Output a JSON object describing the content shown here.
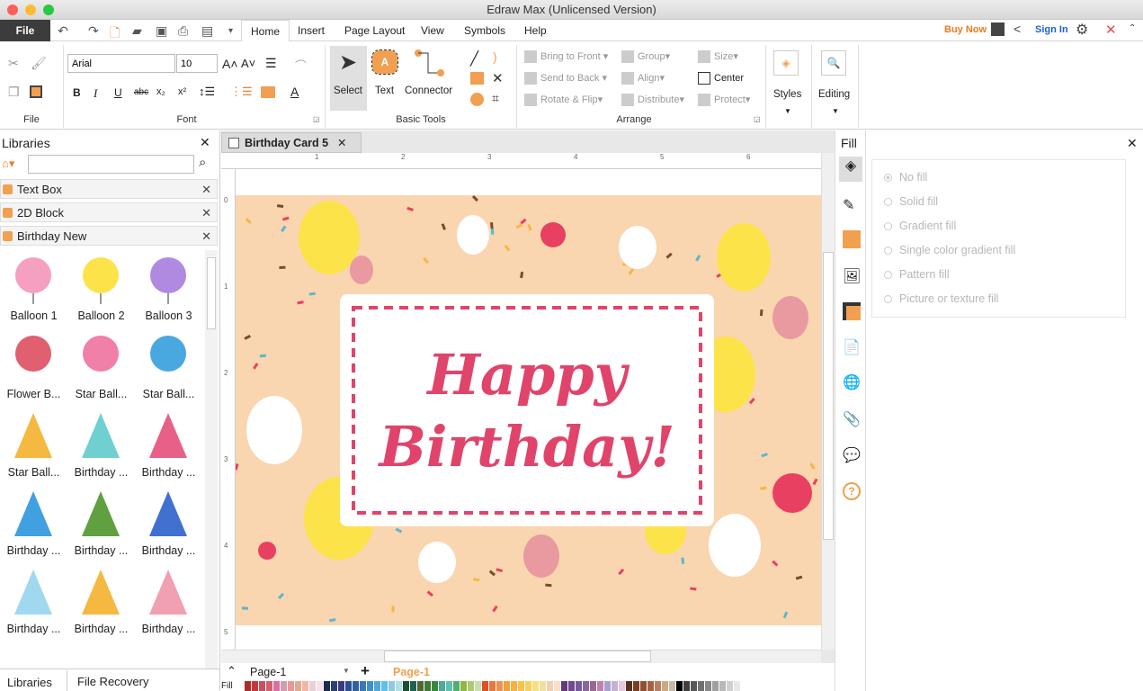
{
  "window": {
    "title": "Edraw Max (Unlicensed Version)"
  },
  "menu": {
    "file": "File",
    "tabs": [
      "Home",
      "Insert",
      "Page Layout",
      "View",
      "Symbols",
      "Help"
    ],
    "active": "Home",
    "buy_now": "Buy Now",
    "sign_in": "Sign In"
  },
  "ribbon": {
    "font": {
      "name": "Arial",
      "size": "10"
    },
    "groups": {
      "file": "File",
      "font": "Font",
      "basic_tools": "Basic Tools",
      "arrange": "Arrange"
    },
    "basic_tools": {
      "select": "Select",
      "text": "Text",
      "connector": "Connector"
    },
    "arrange": {
      "bring_to_front": "Bring to Front",
      "send_to_back": "Send to Back",
      "rotate_flip": "Rotate & Flip",
      "group": "Group",
      "align": "Align",
      "distribute": "Distribute",
      "size": "Size",
      "center": "Center",
      "protect": "Protect"
    },
    "styles": "Styles",
    "editing": "Editing"
  },
  "libraries": {
    "title": "Libraries",
    "search_value": "",
    "categories": [
      "Text Box",
      "2D Block",
      "Birthday New"
    ],
    "shapes": [
      "Balloon 1",
      "Balloon 2",
      "Balloon 3",
      "Flower B...",
      "Star Ball...",
      "Star Ball...",
      "Star Ball...",
      "Birthday ...",
      "Birthday ...",
      "Birthday ...",
      "Birthday ...",
      "Birthday ...",
      "Birthday ...",
      "Birthday ...",
      "Birthday ..."
    ],
    "bottom_tabs": [
      "Libraries",
      "File Recovery"
    ]
  },
  "document": {
    "tab": "Birthday Card 5",
    "card_line1": "Happy",
    "card_line2": "Birthday!",
    "ruler_top": [
      "1",
      "2",
      "3",
      "4",
      "5",
      "6"
    ],
    "ruler_left": [
      "0",
      "1",
      "2",
      "3",
      "4",
      "5"
    ]
  },
  "pages": {
    "current": "Page-1",
    "active_tab": "Page-1",
    "fill_label": "Fill"
  },
  "palette": [
    "#b02a2a",
    "#c83838",
    "#c85060",
    "#d06070",
    "#d870a0",
    "#d89ab0",
    "#e89898",
    "#e8a890",
    "#f0b8a0",
    "#e8d0d8",
    "#f8e0e8",
    "#1a2a50",
    "#2a4070",
    "#3a3a80",
    "#2a5090",
    "#3060a0",
    "#3878b8",
    "#4090c8",
    "#50a8d8",
    "#60c0e8",
    "#90c8e0",
    "#b0e0e8",
    "#1a5030",
    "#206050",
    "#506830",
    "#407838",
    "#38883a",
    "#50a898",
    "#60c0b0",
    "#50b070",
    "#90b840",
    "#b0c870",
    "#c8e0b0",
    "#e05020",
    "#e87840",
    "#f09050",
    "#f0a040",
    "#f8b040",
    "#f8c050",
    "#f8d060",
    "#f8e080",
    "#f0e0a0",
    "#f0d0b0",
    "#f8e0c8",
    "#683878",
    "#704890",
    "#7858a0",
    "#8868a0",
    "#986890",
    "#c080b0",
    "#a8a0d0",
    "#c8b0d0",
    "#e8c8e0",
    "#5a3020",
    "#7a4020",
    "#905030",
    "#a86040",
    "#b88060",
    "#d0a880",
    "#c8b8a8",
    "#000000",
    "#404040",
    "#585858",
    "#707070",
    "#888888",
    "#a0a0a0",
    "#b8b8b8",
    "#d0d0d0",
    "#e8e8e8"
  ],
  "fill_panel": {
    "title": "Fill",
    "options": [
      "No fill",
      "Solid fill",
      "Gradient fill",
      "Single color gradient fill",
      "Pattern fill",
      "Picture or texture fill"
    ],
    "selected": "No fill"
  },
  "colors": {
    "accent": "#f0a050",
    "card_bg": "#f9d5b0",
    "card_text": "#e0446a",
    "buy_now": "#f07820",
    "sign_in": "#1a60d8"
  }
}
